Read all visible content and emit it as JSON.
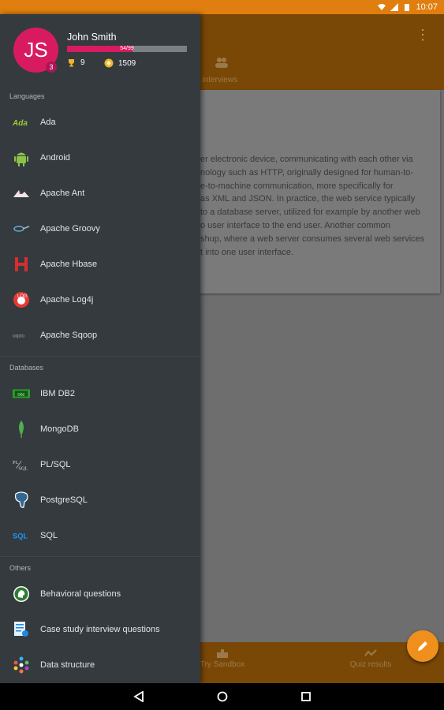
{
  "status_bar": {
    "time": "10:07"
  },
  "app": {
    "tab_label": "Interviews",
    "card_lines": [
      "er electronic device, communicating with each other via",
      "nology such as HTTP, originally designed for human-to-",
      "e-to-machine communication, more specifically for",
      "as XML and JSON. In practice, the web service typically",
      "to a database server, utilized for example by another web",
      "o user interface to the end user. Another common",
      "shup, where a web server consumes several web services",
      "t into one user interface."
    ],
    "bottom_nav": [
      {
        "label": "Try Sandbox",
        "icon": "sandbox-icon"
      },
      {
        "label": "Quiz results",
        "icon": "chart-icon"
      }
    ],
    "fab_icon": "pencil-icon"
  },
  "drawer": {
    "user": {
      "initials": "JS",
      "name": "John Smith",
      "level": "3",
      "xp_text": "54/99",
      "xp_fraction": 0.545,
      "trophies": "9",
      "coins": "1509"
    },
    "sections": [
      {
        "title": "Languages",
        "items": [
          {
            "label": "Ada",
            "icon": "ada-icon"
          },
          {
            "label": "Android",
            "icon": "android-icon"
          },
          {
            "label": "Apache Ant",
            "icon": "apache-ant-icon"
          },
          {
            "label": "Apache Groovy",
            "icon": "groovy-icon"
          },
          {
            "label": "Apache Hbase",
            "icon": "hbase-icon"
          },
          {
            "label": "Apache Log4j",
            "icon": "log4j-icon"
          },
          {
            "label": "Apache Sqoop",
            "icon": "sqoop-icon"
          }
        ]
      },
      {
        "title": "Databases",
        "items": [
          {
            "label": "IBM DB2",
            "icon": "db2-icon"
          },
          {
            "label": "MongoDB",
            "icon": "mongodb-icon"
          },
          {
            "label": "PL/SQL",
            "icon": "plsql-icon"
          },
          {
            "label": "PostgreSQL",
            "icon": "postgresql-icon"
          },
          {
            "label": "SQL",
            "icon": "sql-icon"
          }
        ]
      },
      {
        "title": "Others",
        "items": [
          {
            "label": "Behavioral questions",
            "icon": "behavioral-icon"
          },
          {
            "label": "Case study interview questions",
            "icon": "case-study-icon"
          },
          {
            "label": "Data structure",
            "icon": "data-structure-icon"
          }
        ]
      }
    ]
  },
  "colors": {
    "accent": "#e07e0f",
    "drawer_bg": "#353a3e",
    "avatar": "#d81b60"
  }
}
